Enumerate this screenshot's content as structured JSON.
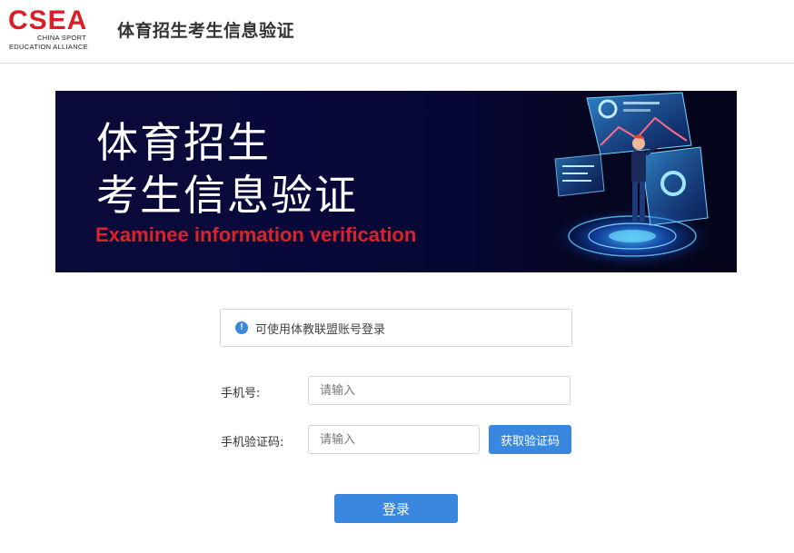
{
  "header": {
    "logo": {
      "mark": "CSEA",
      "line1": "CHINA SPORT",
      "line2": "EDUCATION ALLIANCE"
    },
    "title": "体育招生考生信息验证"
  },
  "banner": {
    "title_line1": "体育招生",
    "title_line2": "考生信息验证",
    "subtitle_en": "Examinee information verification"
  },
  "notice": {
    "icon": "info-icon",
    "text": "可使用体教联盟账号登录"
  },
  "form": {
    "phone": {
      "label": "手机号:",
      "placeholder": "请输入",
      "value": ""
    },
    "code": {
      "label": "手机验证码:",
      "placeholder": "请输入",
      "value": ""
    },
    "get_code_label": "获取验证码",
    "login_label": "登录"
  },
  "colors": {
    "brand_red": "#d91f26",
    "primary_blue": "#3a87e0",
    "banner_dark": "#0a0b3a"
  }
}
